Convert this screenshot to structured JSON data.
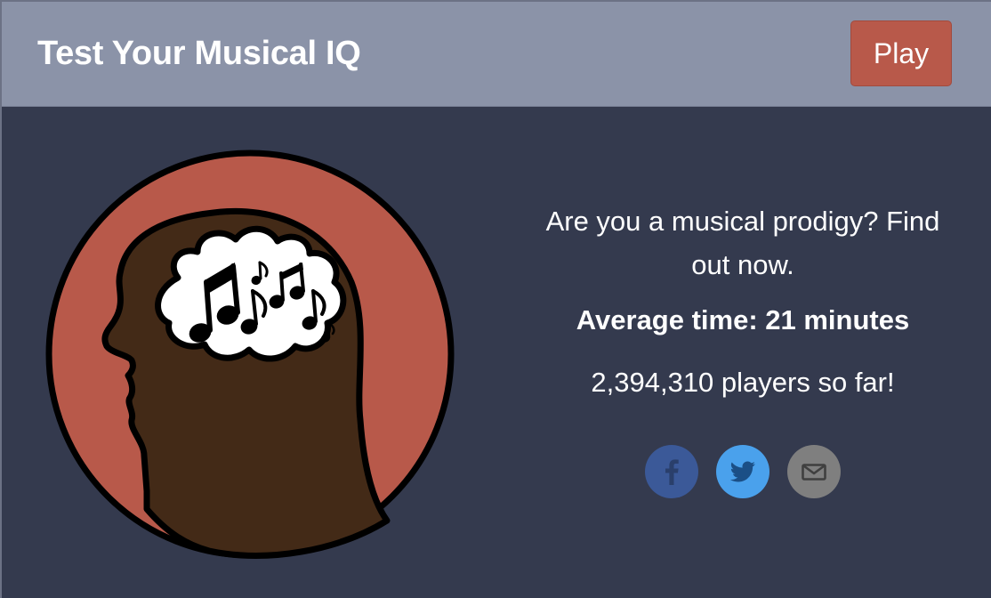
{
  "header": {
    "title": "Test Your Musical IQ",
    "play_label": "Play"
  },
  "main": {
    "tagline": "Are you a musical prodigy? Find out now.",
    "average_time": "Average time: 21 minutes",
    "players": "2,394,310 players so far!"
  },
  "share": {
    "buttons": [
      {
        "network": "facebook",
        "icon": "facebook-icon",
        "color": "#3b5998"
      },
      {
        "network": "twitter",
        "icon": "twitter-icon",
        "color": "#4aa1ec"
      },
      {
        "network": "email",
        "icon": "mail-icon",
        "color": "#7f7f7f"
      }
    ]
  },
  "colors": {
    "header_bg": "#8b93a8",
    "body_bg": "#343a4e",
    "accent": "#b8594a",
    "head_fill": "#432a17"
  }
}
